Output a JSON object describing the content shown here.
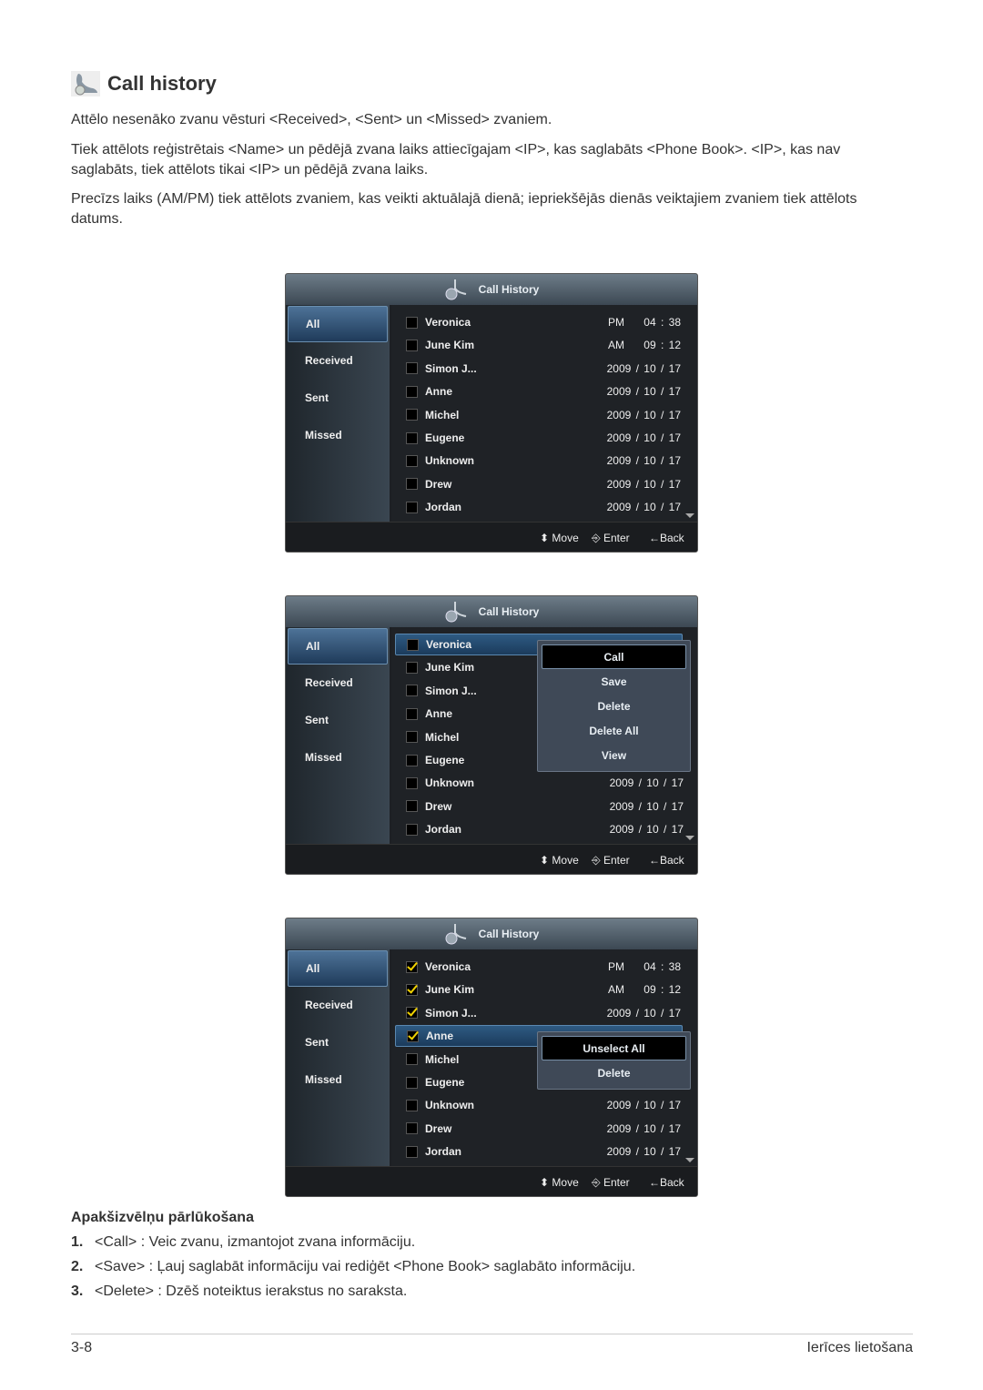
{
  "page": {
    "title": "Call history",
    "paragraphs": [
      "Attēlo nesenāko zvanu vēsturi <Received>, <Sent> un <Missed> zvaniem.",
      "Tiek attēlots reģistrētais <Name> un pēdējā zvana laiks attiecīgajam <IP>, kas saglabāts <Phone Book>. <IP>, kas nav saglabāts, tiek attēlots tikai <IP> un pēdējā zvana laiks.",
      "Precīzs laiks (AM/PM) tiek attēlots zvaniem, kas veikti aktuālajā dienā; iepriekšējās dienās veiktajiem zvaniem tiek attēlots datums."
    ],
    "subheading": "Apakšizvēlņu pārlūkošana",
    "list": [
      {
        "num": "1.",
        "text": "<Call> : Veic zvanu, izmantojot zvana informāciju."
      },
      {
        "num": "2.",
        "text": "<Save> : Ļauj saglabāt informāciju vai rediģēt <Phone Book> saglabāto informāciju."
      },
      {
        "num": "3.",
        "text": "<Delete> : Dzēš noteiktus ierakstus no saraksta."
      }
    ],
    "footer_left": "3-8",
    "footer_right": "Ierīces lietošana"
  },
  "screens": [
    {
      "title": "Call History",
      "tabs": [
        "All",
        "Received",
        "Sent",
        "Missed"
      ],
      "selected_tab": 0,
      "selected_row": -1,
      "rows": [
        {
          "name": "Veronica",
          "right": "PM    04 : 38",
          "checked": false
        },
        {
          "name": "June Kim",
          "right": "AM    09 : 12",
          "checked": false
        },
        {
          "name": "Simon J...",
          "right": "2009 / 10 / 17",
          "checked": false
        },
        {
          "name": "Anne",
          "right": "2009 / 10 / 17",
          "checked": false
        },
        {
          "name": "Michel",
          "right": "2009 / 10 / 17",
          "checked": false
        },
        {
          "name": "Eugene",
          "right": "2009 / 10 / 17",
          "checked": false
        },
        {
          "name": "Unknown",
          "right": "2009 / 10 / 17",
          "checked": false
        },
        {
          "name": "Drew",
          "right": "2009 / 10 / 17",
          "checked": false
        },
        {
          "name": "Jordan",
          "right": "2009 / 10 / 17",
          "checked": false
        }
      ],
      "popup": null,
      "footer": {
        "move": "Move",
        "enter": "Enter",
        "back": "Back"
      }
    },
    {
      "title": "Call History",
      "tabs": [
        "All",
        "Received",
        "Sent",
        "Missed"
      ],
      "selected_tab": 0,
      "selected_row": 0,
      "rows": [
        {
          "name": "Veronica",
          "right": "",
          "checked": false
        },
        {
          "name": "June Kim",
          "right": "",
          "checked": false
        },
        {
          "name": "Simon J...",
          "right": "",
          "checked": false
        },
        {
          "name": "Anne",
          "right": "",
          "checked": false
        },
        {
          "name": "Michel",
          "right": "",
          "checked": false
        },
        {
          "name": "Eugene",
          "right": "",
          "checked": false
        },
        {
          "name": "Unknown",
          "right": "2009 / 10 / 17",
          "checked": false
        },
        {
          "name": "Drew",
          "right": "2009 / 10 / 17",
          "checked": false
        },
        {
          "name": "Jordan",
          "right": "2009 / 10 / 17",
          "checked": false
        }
      ],
      "popup": {
        "items": [
          "Call",
          "Save",
          "Delete",
          "Delete All",
          "View"
        ],
        "selected": 0
      },
      "footer": {
        "move": "Move",
        "enter": "Enter",
        "back": "Back"
      }
    },
    {
      "title": "Call History",
      "tabs": [
        "All",
        "Received",
        "Sent",
        "Missed"
      ],
      "selected_tab": 0,
      "selected_row": 3,
      "rows": [
        {
          "name": "Veronica",
          "right": "PM    04 : 38",
          "checked": true
        },
        {
          "name": "June Kim",
          "right": "AM    09 : 12",
          "checked": true
        },
        {
          "name": "Simon J...",
          "right": "2009 / 10 / 17",
          "checked": true
        },
        {
          "name": "Anne",
          "right": "",
          "checked": true
        },
        {
          "name": "Michel",
          "right": "",
          "checked": false
        },
        {
          "name": "Eugene",
          "right": "",
          "checked": false
        },
        {
          "name": "Unknown",
          "right": "2009 / 10 / 17",
          "checked": false
        },
        {
          "name": "Drew",
          "right": "2009 / 10 / 17",
          "checked": false
        },
        {
          "name": "Jordan",
          "right": "2009 / 10 / 17",
          "checked": false
        }
      ],
      "popup": {
        "items": [
          "Unselect All",
          "Delete"
        ],
        "selected": 0
      },
      "footer": {
        "move": "Move",
        "enter": "Enter",
        "back": "Back"
      }
    }
  ]
}
